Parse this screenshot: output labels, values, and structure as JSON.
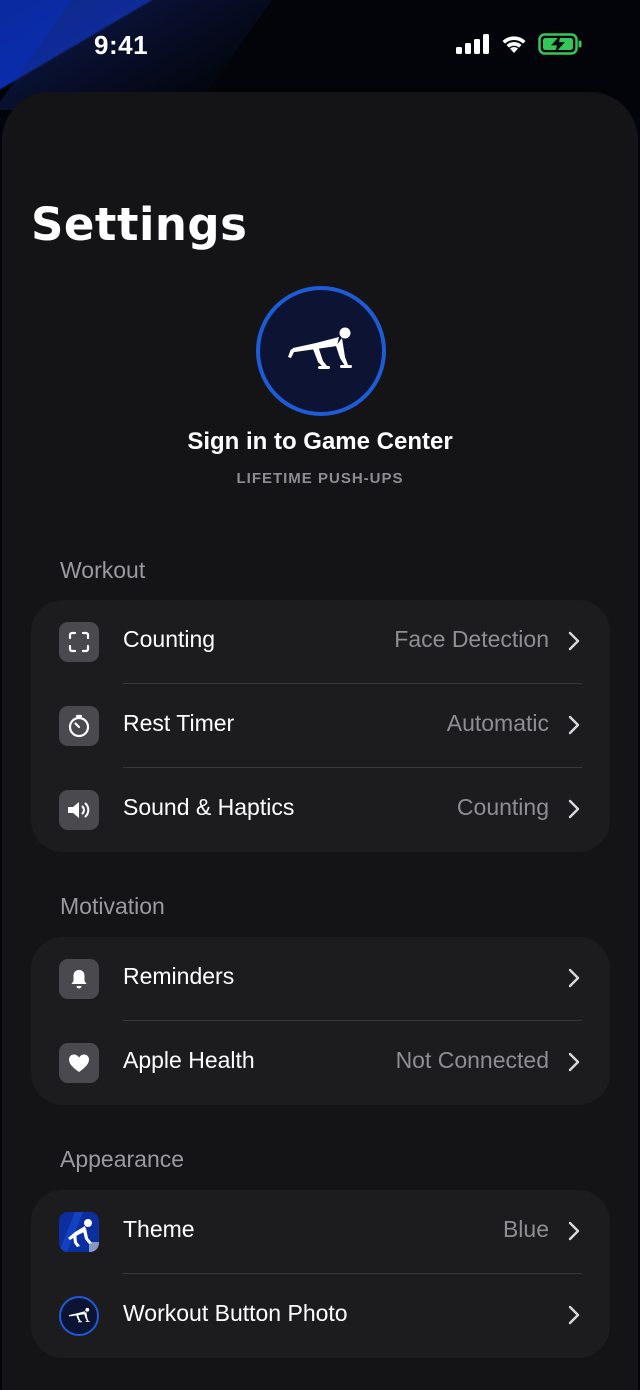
{
  "status_bar": {
    "time": "9:41",
    "signal_icon": "cellular-signal-icon",
    "wifi_icon": "wifi-icon",
    "battery_icon": "battery-charging-icon",
    "battery_color": "#34c759"
  },
  "header": {
    "title": "Settings"
  },
  "game_center": {
    "avatar_icon": "pushup-figure-icon",
    "title": "Sign in to Game Center",
    "subtitle": "LIFETIME PUSH-UPS",
    "ring_color": "#1e5bd6"
  },
  "sections": {
    "workout": {
      "label": "Workout",
      "rows": [
        {
          "label": "Counting",
          "value": "Face Detection",
          "icon": "face-scan-icon"
        },
        {
          "label": "Rest Timer",
          "value": "Automatic",
          "icon": "timer-icon"
        },
        {
          "label": "Sound & Haptics",
          "value": "Counting",
          "icon": "speaker-icon"
        }
      ]
    },
    "motivation": {
      "label": "Motivation",
      "rows": [
        {
          "label": "Reminders",
          "value": "",
          "icon": "bell-icon"
        },
        {
          "label": "Apple Health",
          "value": "Not Connected",
          "icon": "heart-icon"
        }
      ]
    },
    "appearance": {
      "label": "Appearance",
      "rows": [
        {
          "label": "Theme",
          "value": "Blue",
          "icon": "theme-thumbnail-icon"
        },
        {
          "label": "Workout Button Photo",
          "value": "",
          "icon": "workout-button-icon"
        }
      ]
    }
  }
}
